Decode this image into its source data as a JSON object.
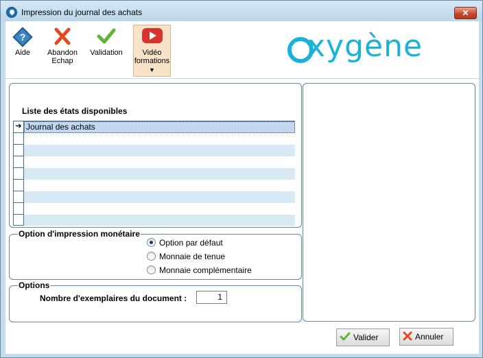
{
  "window": {
    "title": "Impression du journal des achats",
    "close_glyph": "✕"
  },
  "toolbar": {
    "help": {
      "line1": "Aide",
      "icon": "help-diamond-icon"
    },
    "abandon": {
      "line1": "Abandon",
      "line2": "Echap",
      "icon": "red-x-icon"
    },
    "validation": {
      "line1": "Validation",
      "icon": "green-check-icon"
    },
    "video": {
      "line1": "Vidéo",
      "line2": "formations",
      "icon": "youtube-play-icon"
    }
  },
  "logo": {
    "text": "xygène",
    "brand_color": "#1ab2d9"
  },
  "states_list": {
    "title": "Liste des états disponibles",
    "rows": [
      "Journal des achats",
      "",
      "",
      "",
      "",
      "",
      "",
      ""
    ],
    "selected_index": 0,
    "row_marker": "➔"
  },
  "monetary_option": {
    "legend": "Option d'impression monétaire",
    "options": [
      "Option par défaut",
      "Monnaie de tenue",
      "Monnaie complémentaire"
    ],
    "selected_index": 0
  },
  "options": {
    "legend": "Options",
    "copies_label": "Nombre d'exemplaires du document :",
    "copies_value": "1"
  },
  "footer": {
    "validate_label": "Valider",
    "cancel_label": "Annuler"
  },
  "colors": {
    "accent_border": "#5a87b0",
    "stripe": "#d8e9f6",
    "selected_row": "#c3d8f0"
  }
}
